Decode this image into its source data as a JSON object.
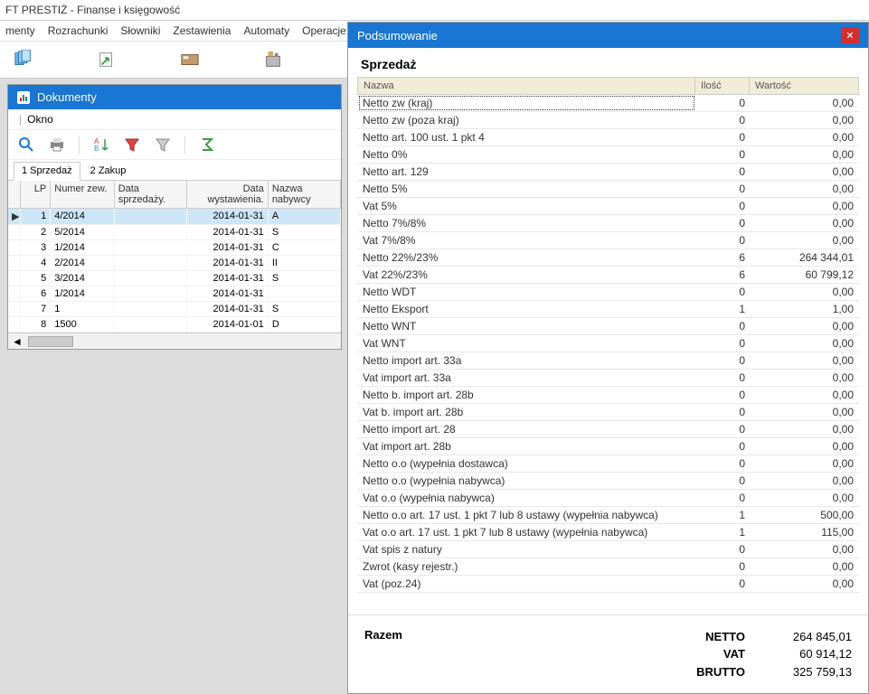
{
  "app_title": "FT PRESTIŻ - Finanse i księgowość",
  "menu": [
    "menty",
    "Rozrachunki",
    "Słowniki",
    "Zestawienia",
    "Automaty",
    "Operacje"
  ],
  "docs": {
    "title": "Dokumenty",
    "okno": "Okno",
    "tabs": [
      {
        "label": "1 Sprzedaż",
        "active": true
      },
      {
        "label": "2 Zakup",
        "active": false
      }
    ],
    "columns": {
      "lp": "LP",
      "numer": "Numer zew.",
      "data_sp": "Data sprzedaży.",
      "data_wy": "Data wystawienia.",
      "nabywca": "Nazwa nabywcy"
    },
    "rows": [
      {
        "lp": "1",
        "numer": "4/2014",
        "data_sp": "",
        "data_wy": "2014-01-31",
        "nabywca": "A",
        "selected": true
      },
      {
        "lp": "2",
        "numer": "5/2014",
        "data_sp": "",
        "data_wy": "2014-01-31",
        "nabywca": "S"
      },
      {
        "lp": "3",
        "numer": "1/2014",
        "data_sp": "",
        "data_wy": "2014-01-31",
        "nabywca": "C"
      },
      {
        "lp": "4",
        "numer": "2/2014",
        "data_sp": "",
        "data_wy": "2014-01-31",
        "nabywca": "II"
      },
      {
        "lp": "5",
        "numer": "3/2014",
        "data_sp": "",
        "data_wy": "2014-01-31",
        "nabywca": "S"
      },
      {
        "lp": "6",
        "numer": "1/2014",
        "data_sp": "",
        "data_wy": "2014-01-31",
        "nabywca": ""
      },
      {
        "lp": "7",
        "numer": "1",
        "data_sp": "",
        "data_wy": "2014-01-31",
        "nabywca": "S"
      },
      {
        "lp": "8",
        "numer": "1500",
        "data_sp": "",
        "data_wy": "2014-01-01",
        "nabywca": "D"
      }
    ]
  },
  "summary": {
    "title": "Podsumowanie",
    "heading": "Sprzedaż",
    "columns": {
      "nazwa": "Nazwa",
      "ilosc": "Ilość",
      "wartosc": "Wartość"
    },
    "rows": [
      {
        "nazwa": "Netto zw (kraj)",
        "ilosc": "0",
        "wartosc": "0,00"
      },
      {
        "nazwa": "Netto zw (poza kraj)",
        "ilosc": "0",
        "wartosc": "0,00"
      },
      {
        "nazwa": "Netto art. 100 ust. 1 pkt 4",
        "ilosc": "0",
        "wartosc": "0,00"
      },
      {
        "nazwa": "Netto 0%",
        "ilosc": "0",
        "wartosc": "0,00"
      },
      {
        "nazwa": "Netto art. 129",
        "ilosc": "0",
        "wartosc": "0,00"
      },
      {
        "nazwa": "Netto 5%",
        "ilosc": "0",
        "wartosc": "0,00"
      },
      {
        "nazwa": "Vat 5%",
        "ilosc": "0",
        "wartosc": "0,00"
      },
      {
        "nazwa": "Netto 7%/8%",
        "ilosc": "0",
        "wartosc": "0,00"
      },
      {
        "nazwa": "Vat 7%/8%",
        "ilosc": "0",
        "wartosc": "0,00"
      },
      {
        "nazwa": "Netto 22%/23%",
        "ilosc": "6",
        "wartosc": "264 344,01"
      },
      {
        "nazwa": "Vat 22%/23%",
        "ilosc": "6",
        "wartosc": "60 799,12"
      },
      {
        "nazwa": "Netto WDT",
        "ilosc": "0",
        "wartosc": "0,00"
      },
      {
        "nazwa": "Netto Eksport",
        "ilosc": "1",
        "wartosc": "1,00"
      },
      {
        "nazwa": "Netto WNT",
        "ilosc": "0",
        "wartosc": "0,00"
      },
      {
        "nazwa": "Vat WNT",
        "ilosc": "0",
        "wartosc": "0,00"
      },
      {
        "nazwa": "Netto import art. 33a",
        "ilosc": "0",
        "wartosc": "0,00"
      },
      {
        "nazwa": "Vat import art. 33a",
        "ilosc": "0",
        "wartosc": "0,00"
      },
      {
        "nazwa": "Netto b. import art. 28b",
        "ilosc": "0",
        "wartosc": "0,00"
      },
      {
        "nazwa": "Vat b. import art. 28b",
        "ilosc": "0",
        "wartosc": "0,00"
      },
      {
        "nazwa": "Netto import art. 28",
        "ilosc": "0",
        "wartosc": "0,00"
      },
      {
        "nazwa": "Vat import art. 28b",
        "ilosc": "0",
        "wartosc": "0,00"
      },
      {
        "nazwa": "Netto o.o (wypełnia dostawca)",
        "ilosc": "0",
        "wartosc": "0,00"
      },
      {
        "nazwa": "Netto o.o (wypełnia nabywca)",
        "ilosc": "0",
        "wartosc": "0,00"
      },
      {
        "nazwa": "Vat o.o (wypełnia nabywca)",
        "ilosc": "0",
        "wartosc": "0,00"
      },
      {
        "nazwa": "Netto o.o  art. 17 ust. 1 pkt 7 lub 8 ustawy (wypełnia nabywca)",
        "ilosc": "1",
        "wartosc": "500,00"
      },
      {
        "nazwa": "Vat o.o  art. 17 ust. 1 pkt 7 lub 8 ustawy (wypełnia nabywca)",
        "ilosc": "1",
        "wartosc": "115,00"
      },
      {
        "nazwa": "Vat spis z natury",
        "ilosc": "0",
        "wartosc": "0,00"
      },
      {
        "nazwa": "Zwrot (kasy rejestr.)",
        "ilosc": "0",
        "wartosc": "0,00"
      },
      {
        "nazwa": "Vat (poz.24)",
        "ilosc": "0",
        "wartosc": "0,00"
      }
    ],
    "razem": "Razem",
    "totals": {
      "netto_label": "NETTO",
      "netto_value": "264 845,01",
      "vat_label": "VAT",
      "vat_value": "60 914,12",
      "brutto_label": "BRUTTO",
      "brutto_value": "325 759,13"
    }
  }
}
